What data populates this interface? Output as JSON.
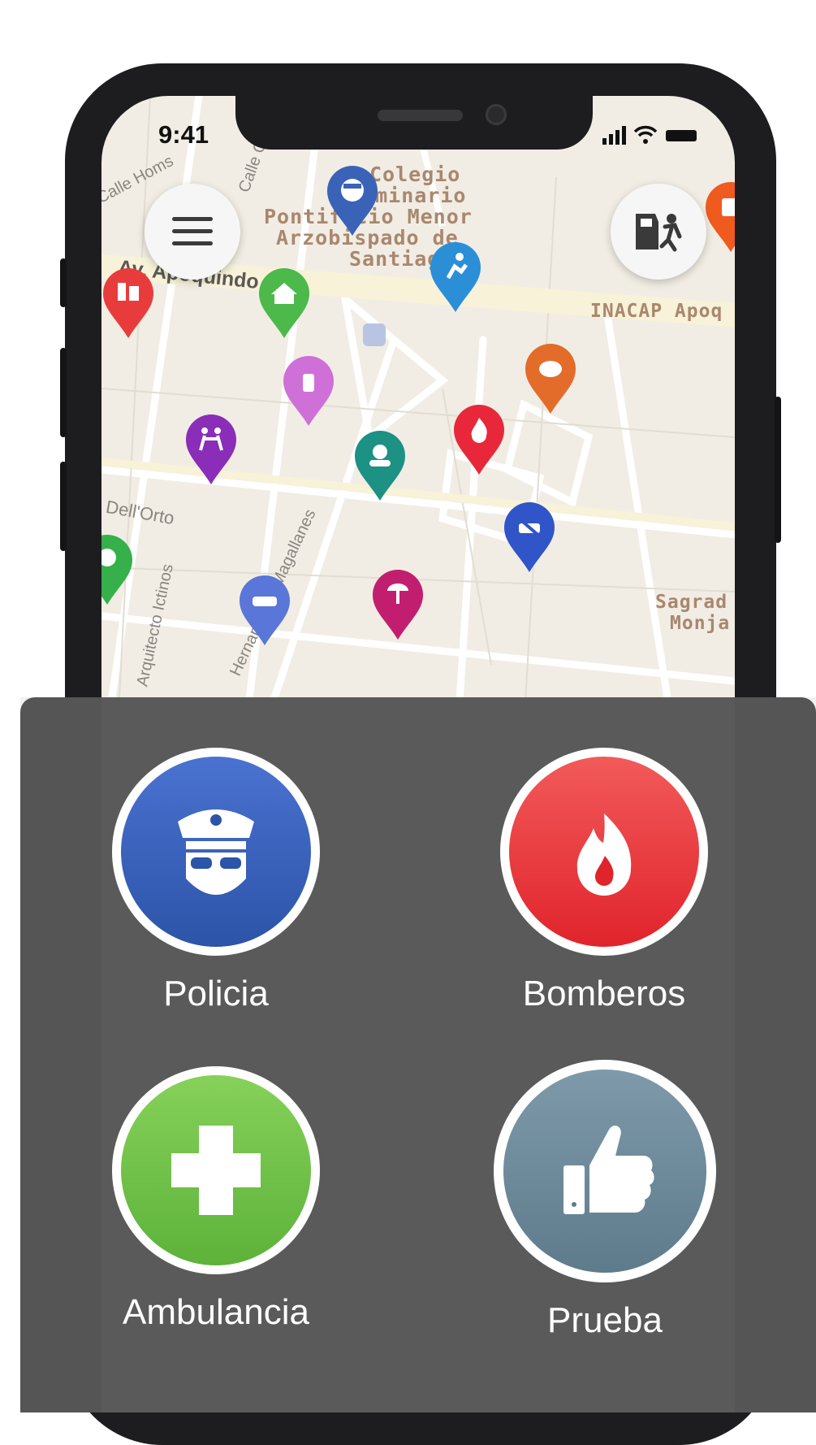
{
  "status_bar": {
    "time": "9:41"
  },
  "map": {
    "labels": {
      "colegio": "Colegio",
      "seminario": "Seminario",
      "pontificio_menor": "Pontificio Menor",
      "arzobispado": "Arzobispado de",
      "santiago": "Santiago",
      "inacap": "INACAP Apoq",
      "sagrado": "Sagrad",
      "monja": "Monja"
    },
    "streets": {
      "calle_homs": "Calle Homs",
      "calle_ge": "Calle Ge",
      "apoquindo": "Av. Apoquindo",
      "dellorto": "Dell'Orto",
      "ictinos": "Arquitecto Ictinos",
      "magallanes": "Hernando de Magallanes"
    },
    "pins": [
      {
        "name": "police",
        "color": "#3a63b8"
      },
      {
        "name": "fight",
        "color": "#e83c3c"
      },
      {
        "name": "home",
        "color": "#4cb94a"
      },
      {
        "name": "runner",
        "color": "#2b8fd8"
      },
      {
        "name": "pharmacy",
        "color": "#e36c2b"
      },
      {
        "name": "spray",
        "color": "#cf6fd8"
      },
      {
        "name": "dance",
        "color": "#8a2db8"
      },
      {
        "name": "person",
        "color": "#1c9184"
      },
      {
        "name": "fire",
        "color": "#e8283a"
      },
      {
        "name": "no-car",
        "color": "#2f55c8"
      },
      {
        "name": "tree",
        "color": "#35b04a"
      },
      {
        "name": "car",
        "color": "#5a76d8"
      },
      {
        "name": "vendor",
        "color": "#c21e70"
      }
    ]
  },
  "services": [
    {
      "label": "Policia",
      "color_top": "#4a72d0",
      "color_bottom": "#2c54a8",
      "icon": "police-icon"
    },
    {
      "label": "Bomberos",
      "color_top": "#f25a5a",
      "color_bottom": "#e0242c",
      "icon": "fire-icon"
    },
    {
      "label": "Ambulancia",
      "color_top": "#86d15a",
      "color_bottom": "#5db23a",
      "icon": "cross-icon"
    },
    {
      "label": "Prueba",
      "color_top": "#7e9aaa",
      "color_bottom": "#5e7b8c",
      "icon": "thumbs-up-icon"
    }
  ]
}
